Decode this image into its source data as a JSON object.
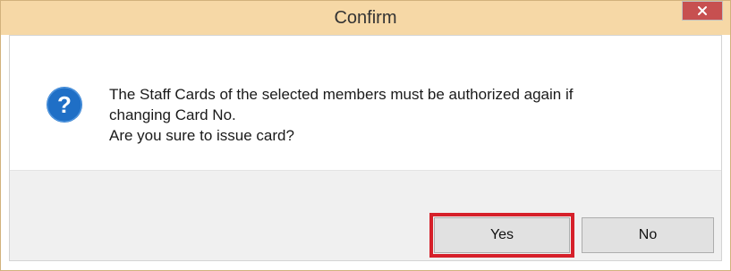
{
  "dialog": {
    "title": "Confirm",
    "close_icon": "close-icon",
    "icon": "question-icon",
    "message_lines": [
      "The Staff Cards of the selected members must be authorized again if",
      "changing Card No.",
      "Are you sure to issue card?"
    ],
    "buttons": {
      "yes_label": "Yes",
      "no_label": "No"
    }
  },
  "colors": {
    "titlebar": "#f6d8a6",
    "close_button": "#c75050",
    "icon_blue": "#1f6fc6",
    "highlight": "#d6202a"
  }
}
